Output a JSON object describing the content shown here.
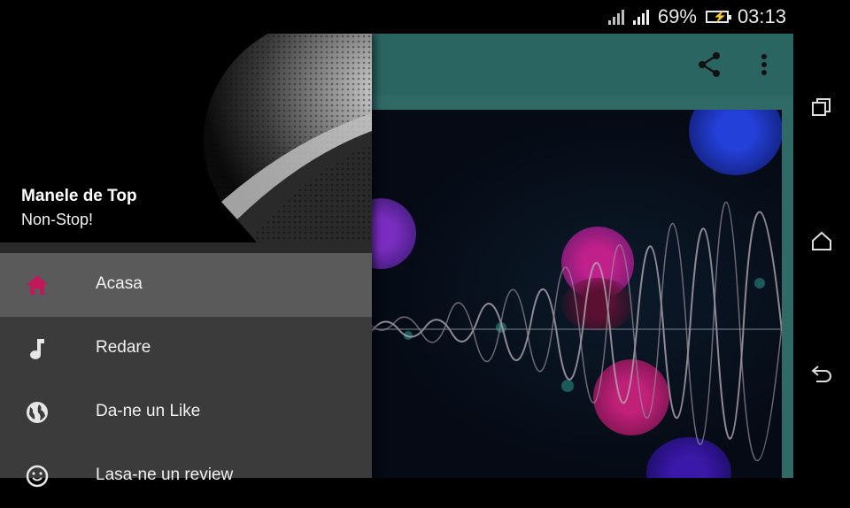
{
  "status_bar": {
    "battery_percent": "69%",
    "time": "03:13"
  },
  "drawer": {
    "title": "Manele de Top",
    "subtitle": "Non-Stop!",
    "items": [
      {
        "label": "Acasa",
        "icon": "home-icon",
        "active": true
      },
      {
        "label": "Redare",
        "icon": "music-note-icon",
        "active": false
      },
      {
        "label": "Da-ne un Like",
        "icon": "globe-icon",
        "active": false
      },
      {
        "label": "Lasa-ne un review",
        "icon": "smiley-icon",
        "active": false
      }
    ]
  },
  "toolbar": {
    "share_icon": "share-icon",
    "more_icon": "more-vert-icon"
  },
  "nav_bar": {
    "recents_icon": "recents-icon",
    "home_icon": "home-outline-icon",
    "back_icon": "back-icon"
  },
  "colors": {
    "accent": "#c2185b",
    "toolbar": "#2b6561",
    "drawer_bg": "#3b3b3b",
    "active_item_bg": "#5a5a5a"
  }
}
